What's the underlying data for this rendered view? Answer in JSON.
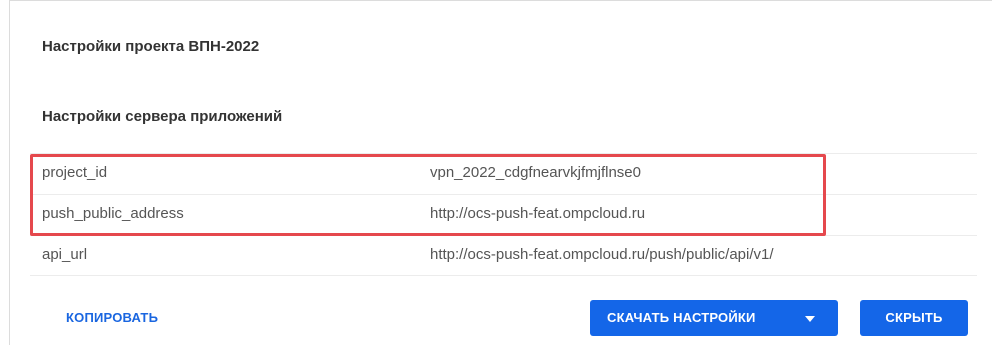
{
  "project_title": "Настройки проекта ВПН-2022",
  "section_title": "Настройки сервера приложений",
  "settings": [
    {
      "key": "project_id",
      "value": "vpn_2022_cdgfnearvkjfmjflnse0"
    },
    {
      "key": "push_public_address",
      "value": "http://ocs-push-feat.ompcloud.ru"
    },
    {
      "key": "api_url",
      "value": "http://ocs-push-feat.ompcloud.ru/push/public/api/v1/"
    }
  ],
  "actions": {
    "copy_label": "КОПИРОВАТЬ",
    "download_label": "СКАЧАТЬ НАСТРОЙКИ",
    "hide_label": "СКРЫТЬ"
  },
  "colors": {
    "accent": "#1466e8",
    "highlight": "#e5484d"
  },
  "icons": {
    "download_dropdown": "chevron-down-icon"
  }
}
